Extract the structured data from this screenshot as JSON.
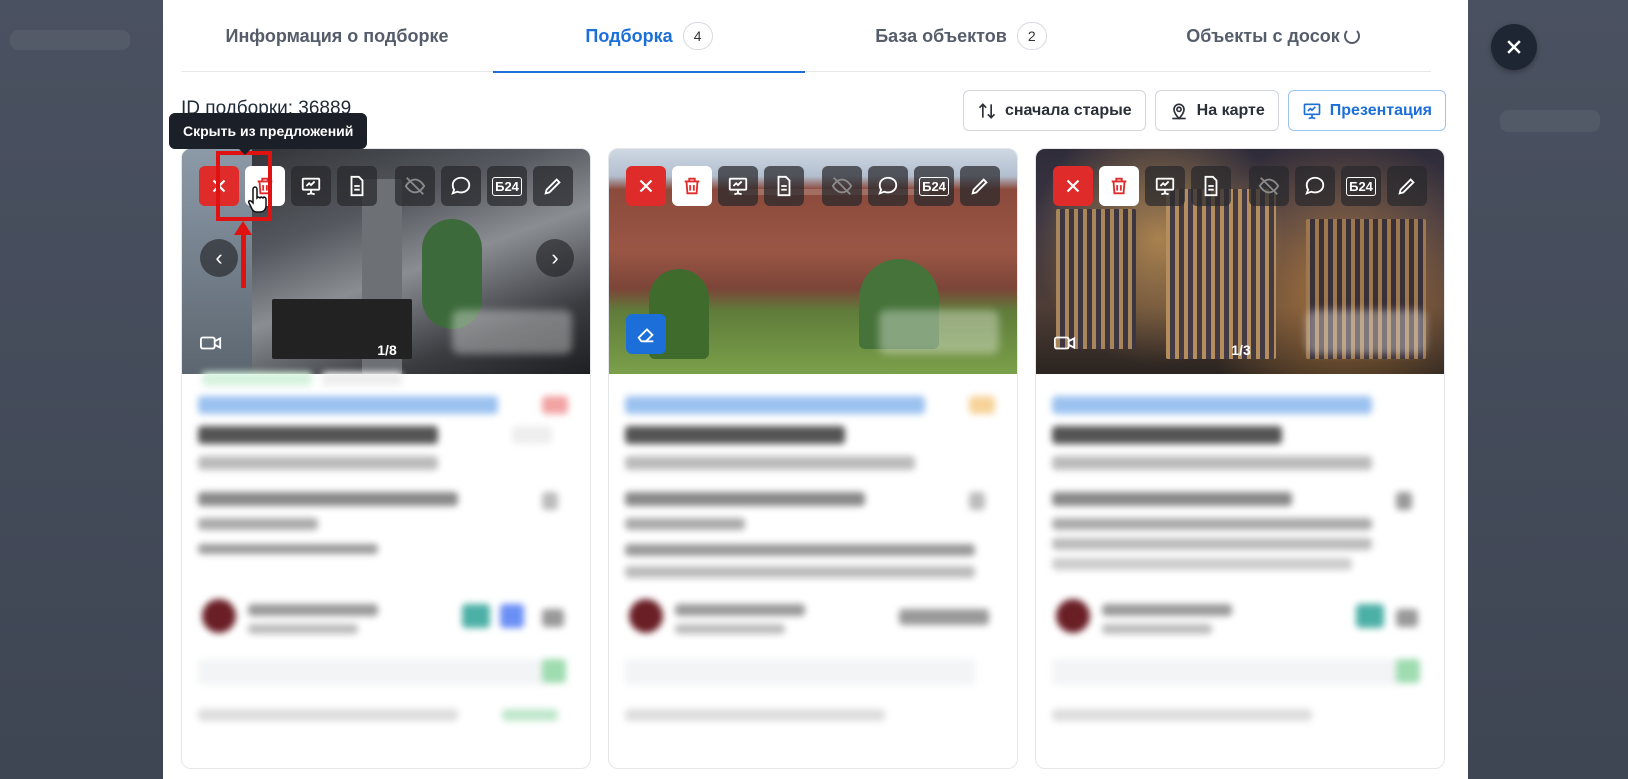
{
  "tabs": [
    {
      "label": "Информация о подборке",
      "count": null,
      "active": false
    },
    {
      "label": "Подборка",
      "count": "4",
      "active": true
    },
    {
      "label": "База объектов",
      "count": "2",
      "active": false
    },
    {
      "label": "Объекты с досок",
      "count": null,
      "active": false,
      "loading": true
    }
  ],
  "selection": {
    "id_label": "ID подборки: 36889"
  },
  "toolbar": {
    "sort_label": "сначала старые",
    "map_label": "На карте",
    "presentation_label": "Презентация"
  },
  "tooltip": {
    "text": "Скрыть из предложений"
  },
  "cards": [
    {
      "counter": "1/8",
      "has_video": true,
      "has_nav": true
    },
    {
      "counter": "",
      "has_video": false,
      "has_nav": false
    },
    {
      "counter": "1/3",
      "has_video": true,
      "has_nav": false
    }
  ],
  "action_icons": [
    "close-icon",
    "trash-icon",
    "presentation-icon",
    "document-icon",
    "eye-off-icon",
    "comment-icon",
    "b24-icon",
    "pencil-icon"
  ],
  "b24_label": "Б24",
  "colors": {
    "accent": "#1c6fd9",
    "danger": "#e02b2b",
    "overlay": "#3a4150"
  }
}
